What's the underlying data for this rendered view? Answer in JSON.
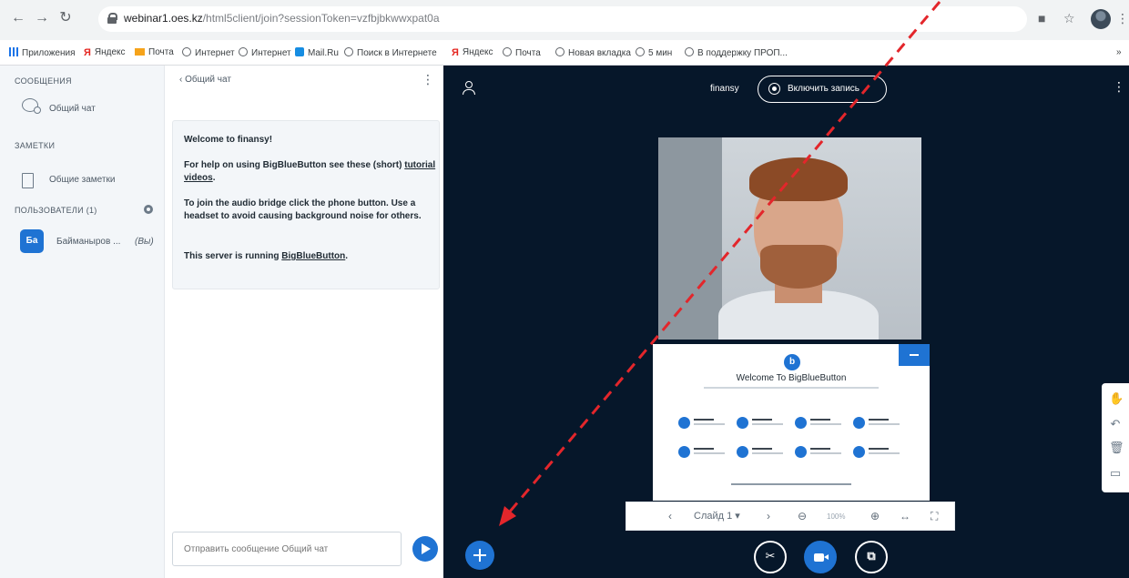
{
  "browser": {
    "url_host": "webinar1.oes.kz",
    "url_path": "/html5client/join?sessionToken=vzfbjbkwwxpat0a",
    "bookmarks": [
      "Приложения",
      "Яндекс",
      "Почта",
      "Интернет",
      "Интернет",
      "Mail.Ru",
      "Поиск в Интернете",
      "Яндекс",
      "Почта",
      "Новая вкладка",
      "5 мин",
      "В поддержку ПРОП..."
    ],
    "bookmarks_overflow": "»"
  },
  "userlist": {
    "messages_title": "СООБЩЕНИЯ",
    "public_chat_label": "Общий чат",
    "notes_title": "ЗАМЕТКИ",
    "shared_notes_label": "Общие заметки",
    "users_title": "ПОЛЬЗОВАТЕЛИ (1)",
    "user_initials": "Ба",
    "user_name": "Байманыров ...",
    "user_you": "(Вы)"
  },
  "chat": {
    "header": "Общий чат",
    "welcome_title": "Welcome to finansy!",
    "help_prefix": "For help on using BigBlueButton see these (short) ",
    "help_link": "tutorial videos",
    "help_suffix": ".",
    "audio_text": "To join the audio bridge click the phone button. Use a headset to avoid causing background noise for others.",
    "server_prefix": "This server is running ",
    "server_link": "BigBlueButton",
    "server_suffix": ".",
    "input_placeholder": "Отправить сообщение Общий чат"
  },
  "presentation": {
    "meeting_name": "finansy",
    "record_label": "Включить запись",
    "slide_title": "Welcome To BigBlueButton",
    "slide_logo": "b",
    "slide_label": "Слайд 1",
    "zoom": "100%"
  },
  "colors": {
    "accent": "#1f73d3",
    "main_background": "#06172a",
    "annotation": "#e3262b"
  },
  "icons": {
    "back": "chevron-left-icon",
    "kebab": "more-vertical-icon",
    "send": "send-icon",
    "plus": "plus-icon",
    "audio": "audio-icon",
    "video": "video-camera-icon",
    "screenshare": "screenshare-icon"
  }
}
